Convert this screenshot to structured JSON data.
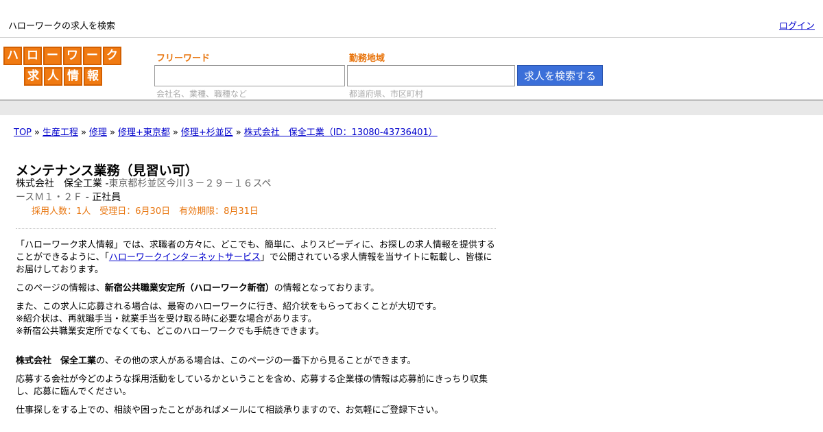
{
  "topbar": {
    "tagline": "ハローワークの求人を検索",
    "login": "ログイン"
  },
  "logo": {
    "row1": [
      "ハ",
      "ロ",
      "ー",
      "ワ",
      "ー",
      "ク"
    ],
    "row2": [
      "求",
      "人",
      "情",
      "報"
    ],
    "color": "#f07a12"
  },
  "search": {
    "keyword_label": "フリーワード",
    "keyword_value": "",
    "keyword_hint": "会社名、業種、職種など",
    "area_label": "勤務地域",
    "area_value": "",
    "area_hint": "都道府県、市区町村",
    "button": "求人を検索する"
  },
  "breadcrumb": {
    "items": [
      "TOP",
      "生産工程",
      "修理",
      "修理+東京都",
      "修理+杉並区",
      "株式会社　保全工業（ID：13080-43736401）"
    ],
    "separator": "»"
  },
  "job": {
    "title": "メンテナンス業務（見習い可）",
    "company": "株式会社　保全工業",
    "dash1": " -",
    "address": "東京都杉並区今川３－２９－１６スペースＭ１・２Ｆ",
    "dash2": " - ",
    "employment": "正社員",
    "stats": "採用人数：1人　受理日：6月30日　有効期限：8月31日"
  },
  "content": {
    "p1_a": "「ハローワーク求人情報」では、求職者の方々に、どこでも、簡単に、よりスピーディに、お探しの求人情報を提供することができるように、「",
    "p1_link": "ハローワークインターネットサービス",
    "p1_b": "」で公開されている求人情報を当サイトに転載し、皆様にお届けしております。",
    "p2_a": "このページの情報は、",
    "p2_bold": "新宿公共職業安定所（ハローワーク新宿）",
    "p2_b": "の情報となっております。",
    "p3_l1": "また、この求人に応募される場合は、最寄のハローワークに行き、紹介状をもらっておくことが大切です。",
    "p3_l2": "※紹介状は、再就職手当・就業手当を受け取る時に必要な場合があります。",
    "p3_l3": "※新宿公共職業安定所でなくても、どこのハローワークでも手続きできます。",
    "p4_bold": "株式会社　保全工業",
    "p4_b": "の、その他の求人がある場合は、このページの一番下から見ることができます。",
    "p5": "応募する会社が今どのような採用活動をしているかということを含め、応募する企業様の情報は応募前にきっちり収集し、応募に臨んでください。",
    "p6": "仕事探しをする上での、相談や困ったことがあればメールにて相談承りますので、お気軽にご登録下さい。"
  }
}
